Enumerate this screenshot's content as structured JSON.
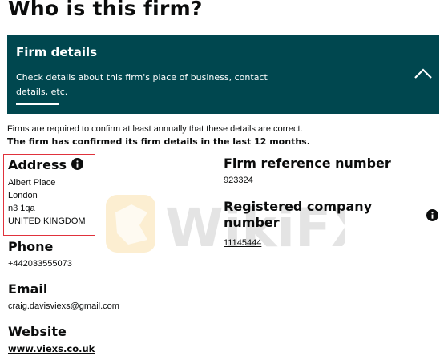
{
  "page": {
    "title": "Who is this firm?"
  },
  "panel": {
    "title": "Firm details",
    "description": "Check details about this firm's place of business, contact details, etc.",
    "background_color": "#00474f",
    "toggle_icon": "chevron-up-icon"
  },
  "confirmation": {
    "note": "Firms are required to confirm at least annually that these details are correct.",
    "status": "The firm has confirmed its firm details in the last 12 months."
  },
  "address": {
    "heading": "Address",
    "info_icon": "info-icon",
    "lines": [
      "Albert Place",
      "London",
      "n3 1qa",
      "UNITED KINGDOM"
    ],
    "highlight_color": "#e0323c"
  },
  "phone": {
    "heading": "Phone",
    "value": "+442033555073"
  },
  "email": {
    "heading": "Email",
    "value": "craig.davisviexs@gmail.com"
  },
  "website": {
    "heading": "Website",
    "value": "www.viexs.co.uk"
  },
  "firm_reference": {
    "heading": "Firm reference number",
    "value": "923324"
  },
  "company_number": {
    "heading": "Registered company number",
    "value": "11145444",
    "info_icon": "info-icon"
  },
  "watermark": {
    "text": "WikiFX"
  }
}
